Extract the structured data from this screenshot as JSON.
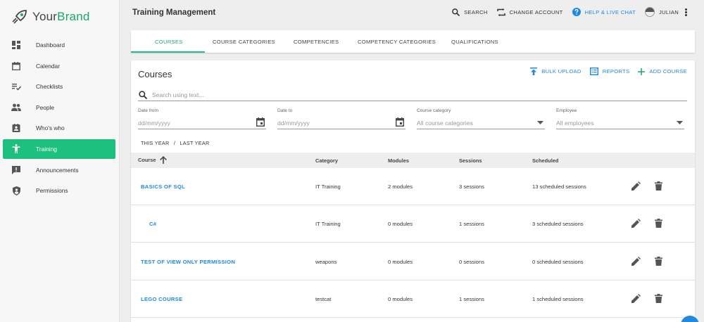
{
  "brand": {
    "name_part1": "Your",
    "name_part2": "Brand"
  },
  "colors": {
    "accent": "#1dc07f",
    "link": "#1e88e5"
  },
  "sidebar": {
    "items": [
      {
        "label": "Dashboard",
        "icon": "dashboard-icon"
      },
      {
        "label": "Calendar",
        "icon": "calendar-icon"
      },
      {
        "label": "Checklists",
        "icon": "checklist-icon"
      },
      {
        "label": "People",
        "icon": "people-icon"
      },
      {
        "label": "Who's who",
        "icon": "contact-card-icon"
      },
      {
        "label": "Training",
        "icon": "training-icon",
        "active": true
      },
      {
        "label": "Announcements",
        "icon": "announcement-icon"
      },
      {
        "label": "Permissions",
        "icon": "shield-icon"
      }
    ]
  },
  "header": {
    "title": "Training Management",
    "search_label": "SEARCH",
    "change_account_label": "CHANGE ACCOUNT",
    "help_label": "HELP & LIVE CHAT",
    "user_name": "JULIAN"
  },
  "tabs": [
    {
      "label": "COURSES",
      "active": true
    },
    {
      "label": "COURSE CATEGORIES"
    },
    {
      "label": "COMPETENCIES"
    },
    {
      "label": "COMPETENCY CATEGORIES"
    },
    {
      "label": "QUALIFICATIONS"
    }
  ],
  "courses": {
    "title": "Courses",
    "bulk_upload_label": "BULK UPLOAD",
    "reports_label": "REPORTS",
    "add_course_label": "ADD COURSE",
    "search_placeholder": "Search using text...",
    "filters": {
      "date_from": {
        "label": "Date from",
        "placeholder": "dd/mm/yyyy"
      },
      "date_to": {
        "label": "Date to",
        "placeholder": "dd/mm/yyyy"
      },
      "course_category": {
        "label": "Course category",
        "value": "All course categories"
      },
      "employee": {
        "label": "Employee",
        "value": "All employees"
      }
    },
    "quick_filters": {
      "this_year": "THIS YEAR",
      "separator": "/",
      "last_year": "LAST YEAR"
    },
    "table": {
      "columns": {
        "course": "Course",
        "category": "Category",
        "modules": "Modules",
        "sessions": "Sessions",
        "scheduled": "Scheduled"
      },
      "sort": {
        "column": "course",
        "direction": "ascending"
      },
      "rows": [
        {
          "name": "BASICS OF SQL",
          "category": "IT Training",
          "modules": "2 modules",
          "sessions": "3 sessions",
          "scheduled": "13 scheduled sessions"
        },
        {
          "name": "C#",
          "category": "IT Training",
          "modules": "0 modules",
          "sessions": "1 sessions",
          "scheduled": "3 scheduled sessions"
        },
        {
          "name": "TEST OF VIEW ONLY PERMISSION",
          "category": "weapons",
          "modules": "0 modules",
          "sessions": "0 sessions",
          "scheduled": "0 scheduled sessions"
        },
        {
          "name": "LEGO COURSE",
          "category": "testcat",
          "modules": "0 modules",
          "sessions": "1 sessions",
          "scheduled": "1 scheduled sessions"
        }
      ]
    }
  }
}
